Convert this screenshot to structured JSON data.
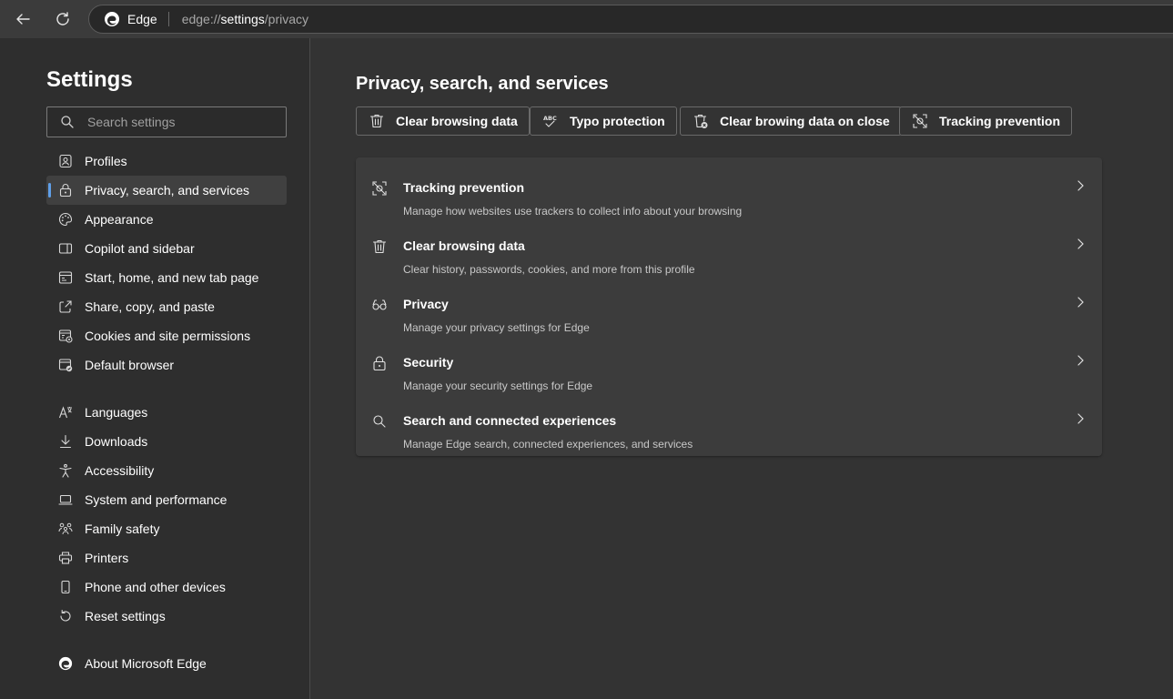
{
  "toolbar": {
    "site_name": "Edge",
    "url_prefix": "edge://",
    "url_bold": "settings",
    "url_suffix": "/privacy"
  },
  "sidebar": {
    "title": "Settings",
    "search_placeholder": "Search settings",
    "items": [
      {
        "label": "Profiles",
        "icon": "profile-icon"
      },
      {
        "label": "Privacy, search, and services",
        "icon": "lock-icon",
        "active": true
      },
      {
        "label": "Appearance",
        "icon": "palette-icon"
      },
      {
        "label": "Copilot and sidebar",
        "icon": "sidebar-icon"
      },
      {
        "label": "Start, home, and new tab page",
        "icon": "home-tab-icon"
      },
      {
        "label": "Share, copy, and paste",
        "icon": "share-icon"
      },
      {
        "label": "Cookies and site permissions",
        "icon": "cookies-icon"
      },
      {
        "label": "Default browser",
        "icon": "default-browser-icon"
      },
      {
        "label": "Languages",
        "icon": "languages-icon"
      },
      {
        "label": "Downloads",
        "icon": "download-icon"
      },
      {
        "label": "Accessibility",
        "icon": "accessibility-icon"
      },
      {
        "label": "System and performance",
        "icon": "laptop-icon"
      },
      {
        "label": "Family safety",
        "icon": "family-icon"
      },
      {
        "label": "Printers",
        "icon": "printer-icon"
      },
      {
        "label": "Phone and other devices",
        "icon": "phone-icon"
      },
      {
        "label": "Reset settings",
        "icon": "reset-icon"
      },
      {
        "label": "About Microsoft Edge",
        "icon": "edge-logo-icon"
      }
    ]
  },
  "main": {
    "title": "Privacy, search, and services",
    "quick_actions": [
      {
        "label": "Clear browsing data",
        "icon": "trash-icon"
      },
      {
        "label": "Typo protection",
        "icon": "spellcheck-icon"
      },
      {
        "label": "Clear browing data on close",
        "icon": "trash-close-icon"
      },
      {
        "label": "Tracking prevention",
        "icon": "tracking-icon"
      }
    ],
    "rows": [
      {
        "title": "Tracking prevention",
        "desc": "Manage how websites use trackers to collect info about your browsing",
        "icon": "tracking-icon"
      },
      {
        "title": "Clear browsing data",
        "desc": "Clear history, passwords, cookies, and more from this profile",
        "icon": "trash-icon"
      },
      {
        "title": "Privacy",
        "desc": "Manage your privacy settings for Edge",
        "icon": "glasses-icon"
      },
      {
        "title": "Security",
        "desc": "Manage your security settings for Edge",
        "icon": "lock-icon"
      },
      {
        "title": "Search and connected experiences",
        "desc": "Manage Edge search, connected experiences, and services",
        "icon": "search-icon"
      }
    ]
  }
}
